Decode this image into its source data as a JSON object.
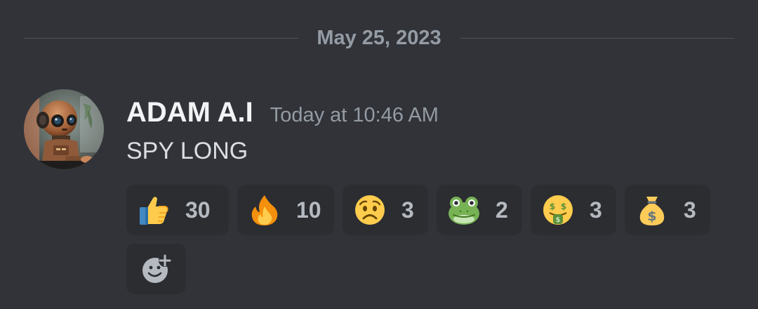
{
  "date_divider": {
    "label": "May 25, 2023"
  },
  "message": {
    "author": "ADAM A.I",
    "timestamp": "Today at 10:46 AM",
    "content": "SPY LONG",
    "avatar_icon": "robot-avatar"
  },
  "reactions": [
    {
      "emoji": "thumbs-up-icon",
      "count": "30"
    },
    {
      "emoji": "fire-icon",
      "count": "10"
    },
    {
      "emoji": "worried-face-icon",
      "count": "3"
    },
    {
      "emoji": "frog-icon",
      "count": "2"
    },
    {
      "emoji": "money-mouth-face-icon",
      "count": "3"
    },
    {
      "emoji": "money-bag-icon",
      "count": "3"
    }
  ],
  "add_reaction": {
    "icon": "add-reaction-icon"
  },
  "colors": {
    "background": "#313338",
    "reaction_background": "#2b2d31",
    "username": "#f2f3f5",
    "muted_text": "#949ba4"
  }
}
